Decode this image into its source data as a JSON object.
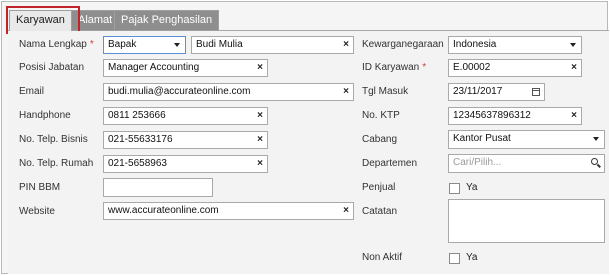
{
  "tabs": [
    {
      "label": "Karyawan",
      "active": true
    },
    {
      "label": "Alamat",
      "active": false
    },
    {
      "label": "Pajak Penghasilan",
      "active": false
    }
  ],
  "left": {
    "nama_lengkap": {
      "label": "Nama Lengkap",
      "required": "*",
      "salutation": "Bapak",
      "name": "Budi Mulia"
    },
    "posisi_jabatan": {
      "label": "Posisi Jabatan",
      "value": "Manager Accounting"
    },
    "email": {
      "label": "Email",
      "value": "budi.mulia@accurateonline.com"
    },
    "handphone": {
      "label": "Handphone",
      "value": "0811 253666"
    },
    "telp_bisnis": {
      "label": "No. Telp. Bisnis",
      "value": "021-55633176"
    },
    "telp_rumah": {
      "label": "No. Telp. Rumah",
      "value": "021-5658963"
    },
    "pin_bbm": {
      "label": "PIN BBM",
      "value": ""
    },
    "website": {
      "label": "Website",
      "value": "www.accurateonline.com"
    }
  },
  "right": {
    "kewarganegaraan": {
      "label": "Kewarganegaraan",
      "value": "Indonesia"
    },
    "id_karyawan": {
      "label": "ID Karyawan",
      "required": "*",
      "value": "E.00002"
    },
    "tgl_masuk": {
      "label": "Tgl Masuk",
      "value": "23/11/2017"
    },
    "no_ktp": {
      "label": "No. KTP",
      "value": "12345637896312"
    },
    "cabang": {
      "label": "Cabang",
      "value": "Kantor Pusat"
    },
    "departemen": {
      "label": "Departemen",
      "placeholder": "Cari/Pilih..."
    },
    "penjual": {
      "label": "Penjual",
      "option": "Ya",
      "checked": false
    },
    "catatan": {
      "label": "Catatan",
      "value": ""
    },
    "non_aktif": {
      "label": "Non Aktif",
      "option": "Ya",
      "checked": false
    }
  },
  "icons": {
    "clear": "×",
    "dropdown": "chevron-down-icon",
    "calendar": "calendar-icon",
    "search": "search-icon"
  },
  "colors": {
    "highlight": "#c2232b",
    "focus": "#5b8fd6",
    "tab_inactive": "#8e8e8e",
    "required": "#d23a3a"
  }
}
